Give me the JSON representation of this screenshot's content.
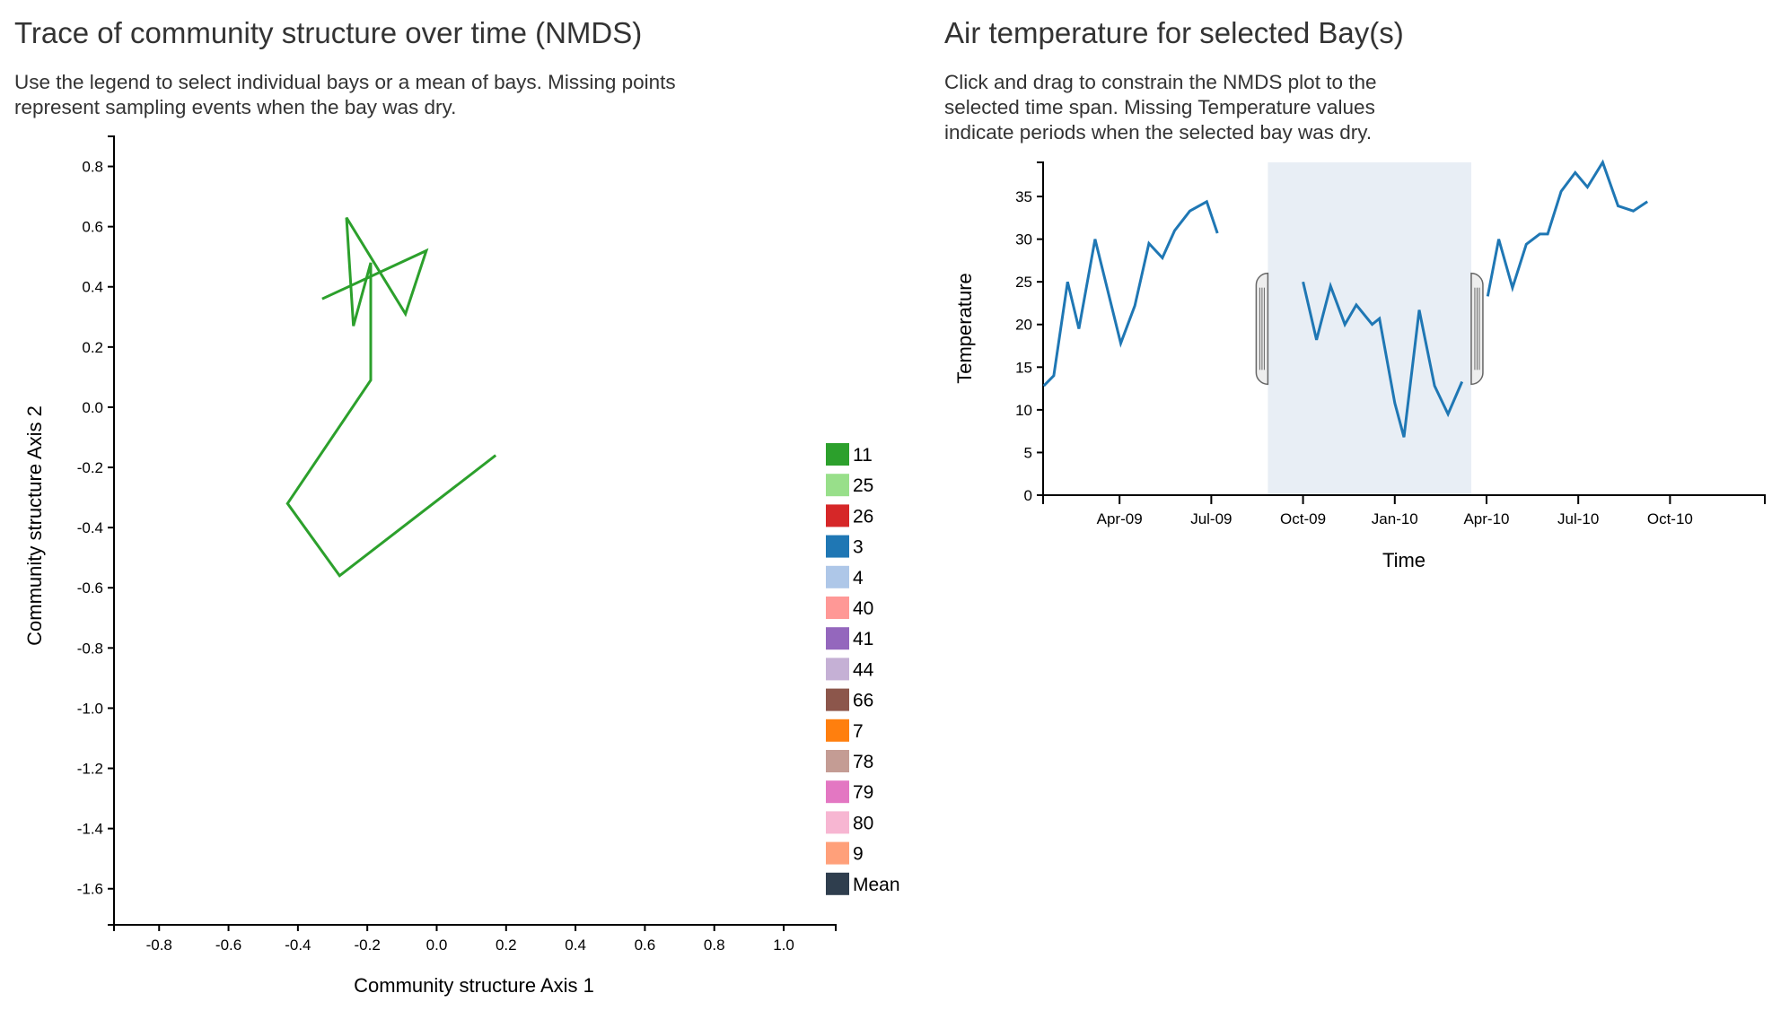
{
  "left_panel": {
    "title": "Trace of community structure over time (NMDS)",
    "description": "Use the legend to select individual bays or a mean of bays. Missing points represent sampling events when the bay was dry."
  },
  "right_panel": {
    "title": "Air temperature for selected Bay(s)",
    "description": "Click and drag to constrain the NMDS plot to the selected time span. Missing Temperature values indicate periods when the selected bay was dry."
  },
  "chart_data": [
    {
      "type": "line",
      "id": "nmds",
      "title": "Trace of community structure over time (NMDS)",
      "xlabel": "Community structure Axis 1",
      "ylabel": "Community structure Axis 2",
      "xlim": [
        -0.93,
        1.15
      ],
      "ylim": [
        -1.72,
        0.9
      ],
      "xticks": [
        "-0.8",
        "-0.6",
        "-0.4",
        "-0.2",
        "0.0",
        "0.2",
        "0.4",
        "0.6",
        "0.8",
        "1.0"
      ],
      "yticks": [
        "0.8",
        "0.6",
        "0.4",
        "0.2",
        "0.0",
        "-0.2",
        "-0.4",
        "-0.6",
        "-0.8",
        "-1.0",
        "-1.2",
        "-1.4",
        "-1.6"
      ],
      "grid": false,
      "legend_position": "right",
      "series": [
        {
          "name": "11",
          "color": "#2ca02c",
          "points": [
            [
              -0.33,
              0.36
            ],
            [
              -0.03,
              0.52
            ],
            [
              -0.09,
              0.31
            ],
            [
              -0.26,
              0.63
            ],
            [
              -0.24,
              0.27
            ],
            [
              -0.19,
              0.48
            ],
            [
              -0.19,
              0.09
            ],
            [
              -0.43,
              -0.32
            ],
            [
              -0.28,
              -0.56
            ],
            [
              0.17,
              -0.16
            ]
          ]
        }
      ],
      "legend": [
        {
          "label": "11",
          "color": "#2ca02c",
          "selected": true
        },
        {
          "label": "25",
          "color": "#98df8a",
          "selected": false
        },
        {
          "label": "26",
          "color": "#d62728",
          "selected": false
        },
        {
          "label": "3",
          "color": "#1f77b4",
          "selected": false
        },
        {
          "label": "4",
          "color": "#aec7e8",
          "selected": false
        },
        {
          "label": "40",
          "color": "#ff9896",
          "selected": false
        },
        {
          "label": "41",
          "color": "#9467bd",
          "selected": false
        },
        {
          "label": "44",
          "color": "#c5b0d5",
          "selected": false
        },
        {
          "label": "66",
          "color": "#8c564b",
          "selected": false
        },
        {
          "label": "7",
          "color": "#ff7f0e",
          "selected": false
        },
        {
          "label": "78",
          "color": "#c49c94",
          "selected": false
        },
        {
          "label": "79",
          "color": "#e377c2",
          "selected": false
        },
        {
          "label": "80",
          "color": "#f7b6d2",
          "selected": false
        },
        {
          "label": "9",
          "color": "#ffa07a",
          "selected": false
        },
        {
          "label": "Mean",
          "color": "#2f3e4e",
          "selected": false
        }
      ]
    },
    {
      "type": "line",
      "id": "temperature",
      "title": "Air temperature for selected Bay(s)",
      "xlabel": "Time",
      "ylabel": "Temperature",
      "x_unit": "months since Jan-09",
      "xlim": [
        0.5,
        24.1
      ],
      "ylim": [
        0,
        39
      ],
      "xticks": [
        {
          "label": "Apr-09",
          "value": 3
        },
        {
          "label": "Jul-09",
          "value": 6
        },
        {
          "label": "Oct-09",
          "value": 9
        },
        {
          "label": "Jan-10",
          "value": 12
        },
        {
          "label": "Apr-10",
          "value": 15
        },
        {
          "label": "Jul-10",
          "value": 18
        },
        {
          "label": "Oct-10",
          "value": 21
        }
      ],
      "yticks": [
        "0",
        "5",
        "10",
        "15",
        "20",
        "25",
        "30",
        "35"
      ],
      "grid": false,
      "color": "#1f77b4",
      "brush": {
        "start": 7.85,
        "end": 14.5,
        "fill": "#e8eef5"
      },
      "segments": [
        [
          [
            0.52,
            12.8
          ],
          [
            0.85,
            14
          ],
          [
            1.3,
            25
          ],
          [
            1.67,
            19.5
          ],
          [
            2.2,
            30
          ],
          [
            3.04,
            17.8
          ],
          [
            3.5,
            22.2
          ],
          [
            3.96,
            29.5
          ],
          [
            4.4,
            27.8
          ],
          [
            4.8,
            31
          ],
          [
            5.3,
            33.3
          ],
          [
            5.85,
            34.4
          ],
          [
            6.2,
            30.7
          ]
        ],
        [
          [
            9,
            25
          ],
          [
            9.44,
            18.2
          ],
          [
            9.9,
            24.5
          ],
          [
            10.37,
            20
          ],
          [
            10.74,
            22.3
          ],
          [
            11.26,
            20
          ],
          [
            11.5,
            20.7
          ],
          [
            12,
            10.8
          ],
          [
            12.3,
            6.8
          ],
          [
            12.8,
            21.7
          ],
          [
            13.3,
            12.8
          ],
          [
            13.74,
            9.5
          ],
          [
            14.2,
            13.3
          ]
        ],
        [
          [
            15.04,
            23.3
          ],
          [
            15.4,
            30
          ],
          [
            15.85,
            24.3
          ],
          [
            16.3,
            29.4
          ],
          [
            16.74,
            30.6
          ],
          [
            17,
            30.6
          ],
          [
            17.44,
            35.6
          ],
          [
            17.9,
            37.8
          ],
          [
            18.3,
            36.1
          ],
          [
            18.8,
            39
          ],
          [
            19.3,
            33.9
          ],
          [
            19.8,
            33.3
          ],
          [
            20.26,
            34.4
          ]
        ]
      ]
    }
  ]
}
